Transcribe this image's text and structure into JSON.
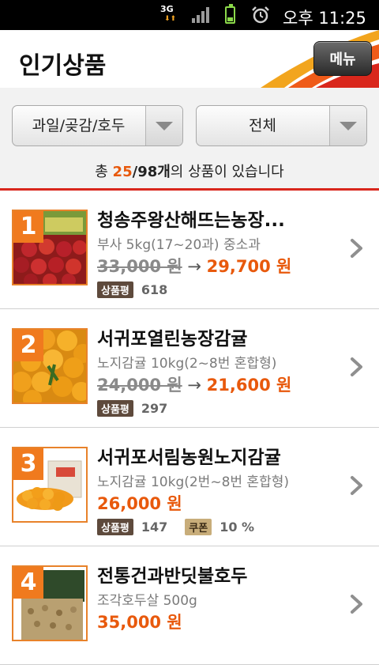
{
  "status_bar": {
    "network": "3G",
    "time": "오후 11:25",
    "icons": [
      "data-arrows-icon",
      "signal-icon",
      "battery-icon",
      "alarm-icon"
    ]
  },
  "header": {
    "title": "인기상품",
    "menu_label": "메뉴"
  },
  "filters": {
    "category": "과일/곶감/호두",
    "scope": "전체"
  },
  "summary": {
    "prefix": "총 ",
    "shown": "25",
    "separator": "/",
    "total": "98개",
    "suffix": "의 상품이 있습니다"
  },
  "colors": {
    "accent": "#e8590c",
    "rule": "#d9271c",
    "badge": "#5e4a3c",
    "coupon": "#c8ad7a"
  },
  "products": [
    {
      "rank": "1",
      "name": "청송주왕산해뜨는농장...",
      "desc": "부사 5kg(17~20과) 중소과",
      "old_price": "33,000 원",
      "arrow": "→",
      "price": "29,700 원",
      "review_label": "상품평",
      "reviews": "618"
    },
    {
      "rank": "2",
      "name": "서귀포열린농장감귤",
      "desc": "노지감귤 10kg(2~8번 혼합형)",
      "old_price": "24,000 원",
      "arrow": "→",
      "price": "21,600 원",
      "review_label": "상품평",
      "reviews": "297"
    },
    {
      "rank": "3",
      "name": "서귀포서림농원노지감귤",
      "desc": "노지감귤 10kg(2번~8번 혼합형)",
      "price": "26,000 원",
      "review_label": "상품평",
      "reviews": "147",
      "coupon_label": "쿠폰",
      "coupon": "10 %"
    },
    {
      "rank": "4",
      "name": "전통건과반딧불호두",
      "desc": "조각호두살 500g",
      "price": "35,000 원"
    }
  ]
}
